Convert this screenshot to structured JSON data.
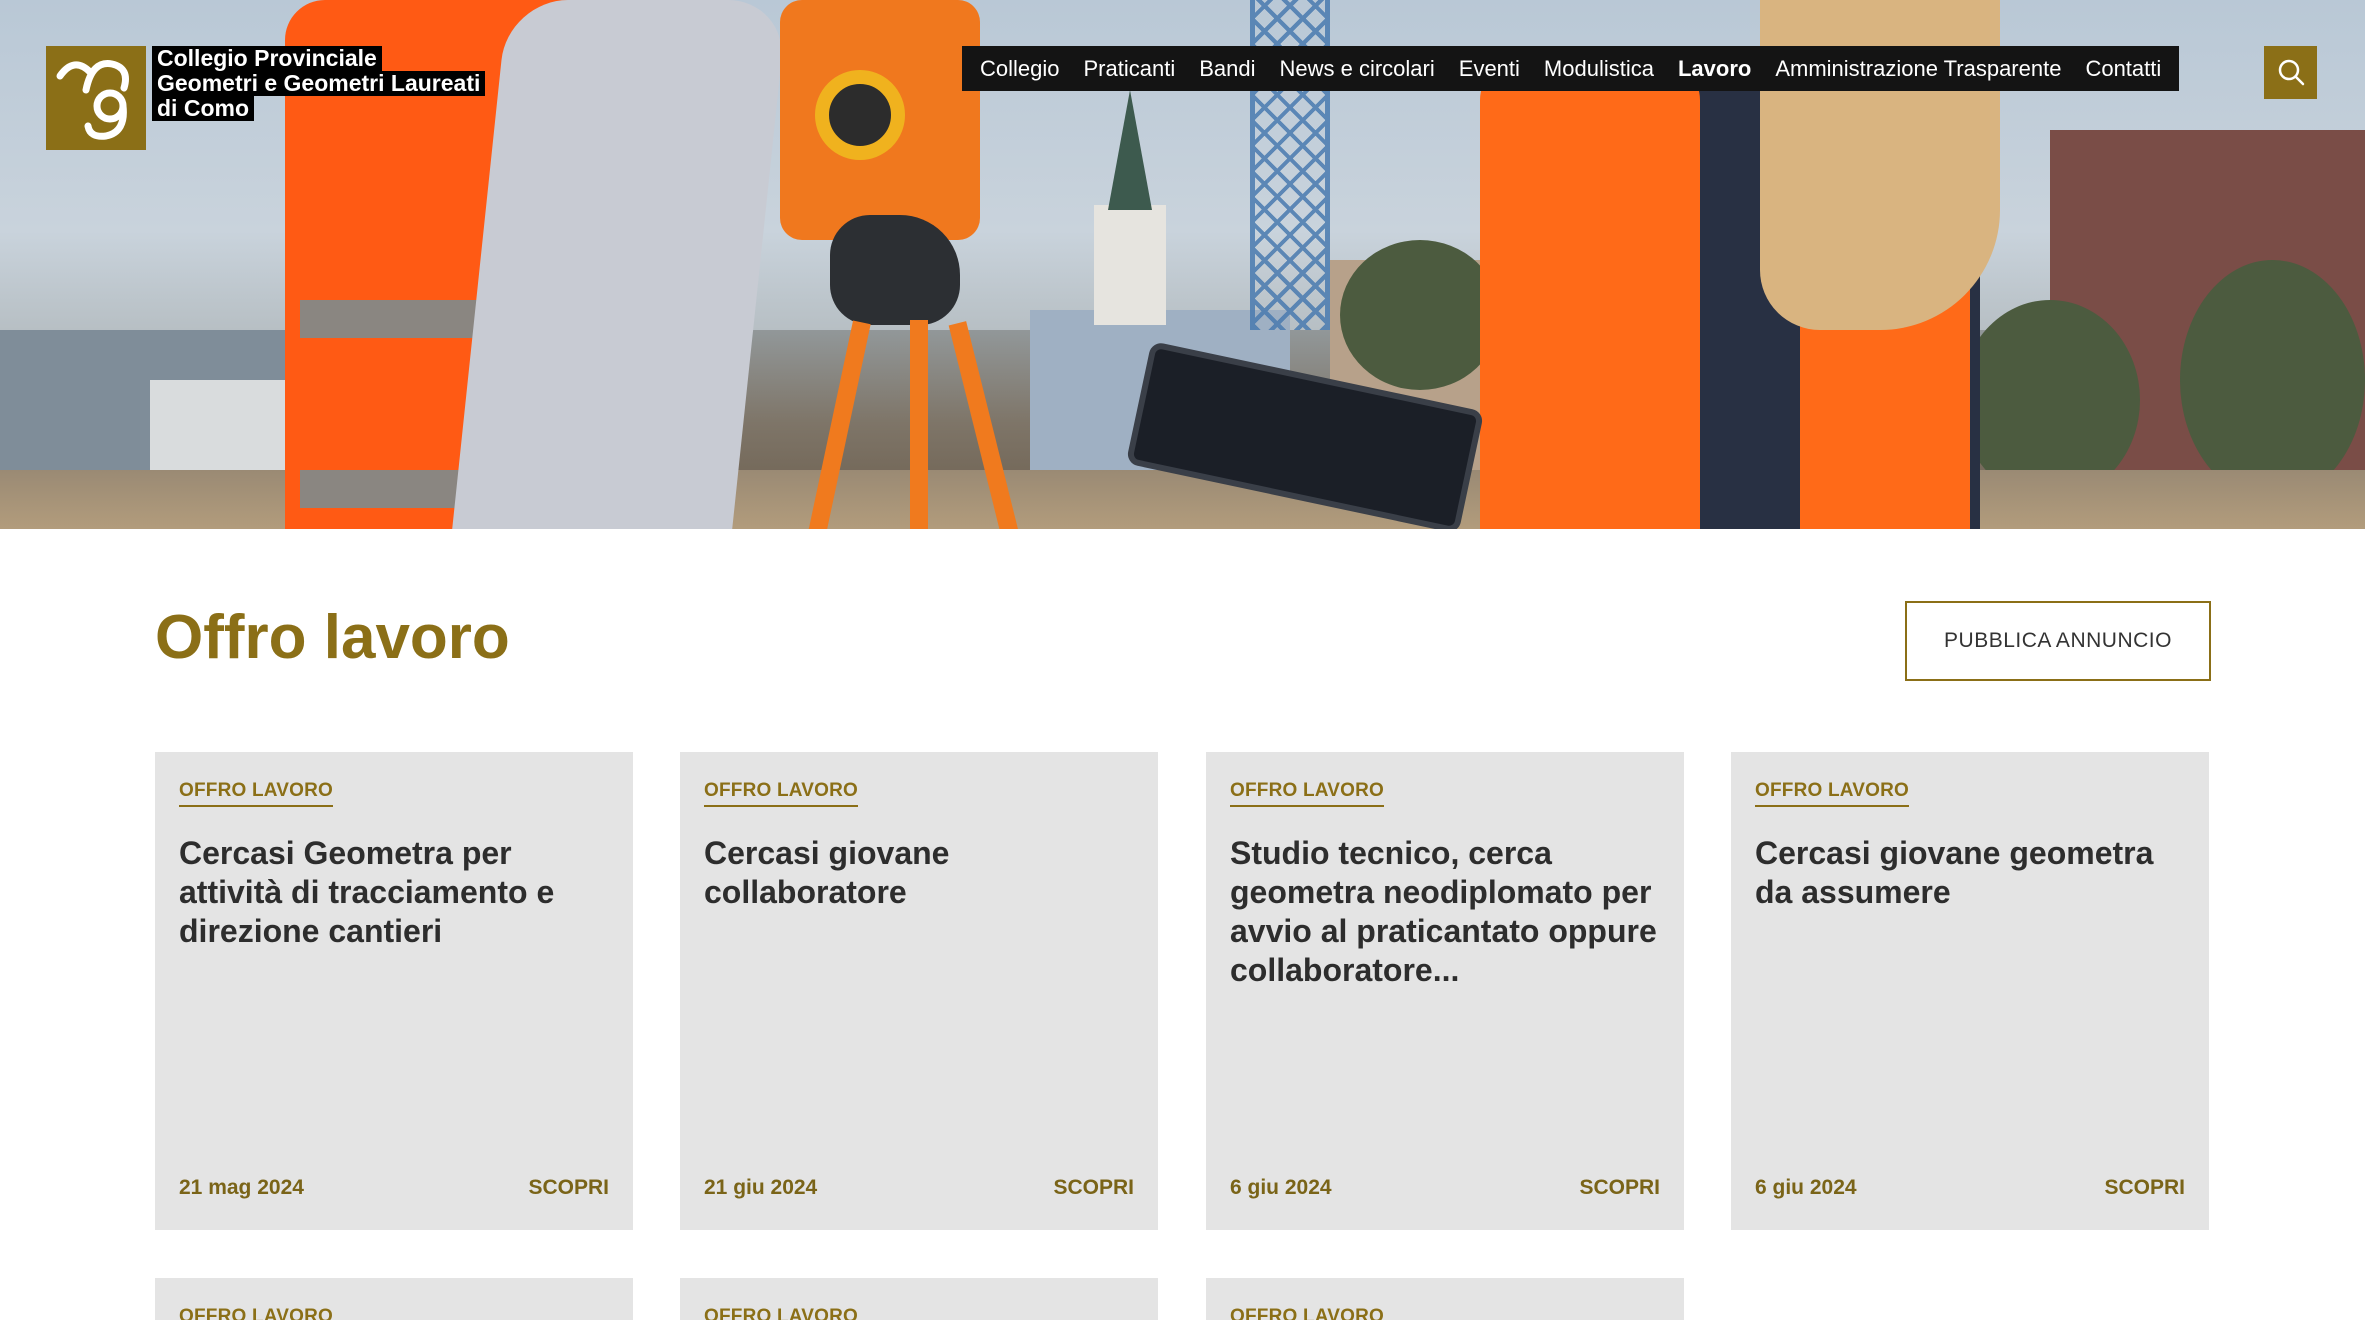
{
  "logo": {
    "line1": "Collegio Provinciale",
    "line2": "Geometri e Geometri Laureati",
    "line3": "di Como"
  },
  "nav": {
    "items": [
      {
        "label": "Collegio",
        "active": false
      },
      {
        "label": "Praticanti",
        "active": false
      },
      {
        "label": "Bandi",
        "active": false
      },
      {
        "label": "News e circolari",
        "active": false
      },
      {
        "label": "Eventi",
        "active": false
      },
      {
        "label": "Modulistica",
        "active": false
      },
      {
        "label": "Lavoro",
        "active": true
      },
      {
        "label": "Amministrazione Trasparente",
        "active": false
      },
      {
        "label": "Contatti",
        "active": false
      }
    ],
    "search_icon": "search-icon"
  },
  "page": {
    "title": "Offro lavoro",
    "publish_button": "PUBBLICA ANNUNCIO"
  },
  "cards": [
    {
      "category": "OFFRO LAVORO",
      "title": "Cercasi Geometra per attività di tracciamento e direzione cantieri",
      "date": "21 mag 2024",
      "more": "SCOPRI"
    },
    {
      "category": "OFFRO LAVORO",
      "title": "Cercasi giovane collaboratore",
      "date": "21 giu 2024",
      "more": "SCOPRI"
    },
    {
      "category": "OFFRO LAVORO",
      "title": "Studio tecnico, cerca geometra neodiplomato per avvio al praticantato oppure collaboratore...",
      "date": "6 giu 2024",
      "more": "SCOPRI"
    },
    {
      "category": "OFFRO LAVORO",
      "title": "Cercasi giovane geometra da assumere",
      "date": "6 giu 2024",
      "more": "SCOPRI"
    }
  ],
  "cards_row2": [
    {
      "category": "OFFRO LAVORO"
    },
    {
      "category": "OFFRO LAVORO"
    },
    {
      "category": "OFFRO LAVORO"
    }
  ],
  "colors": {
    "brand": "#8b6f17",
    "nav_bg": "#141414",
    "card_bg": "#e4e4e4"
  }
}
